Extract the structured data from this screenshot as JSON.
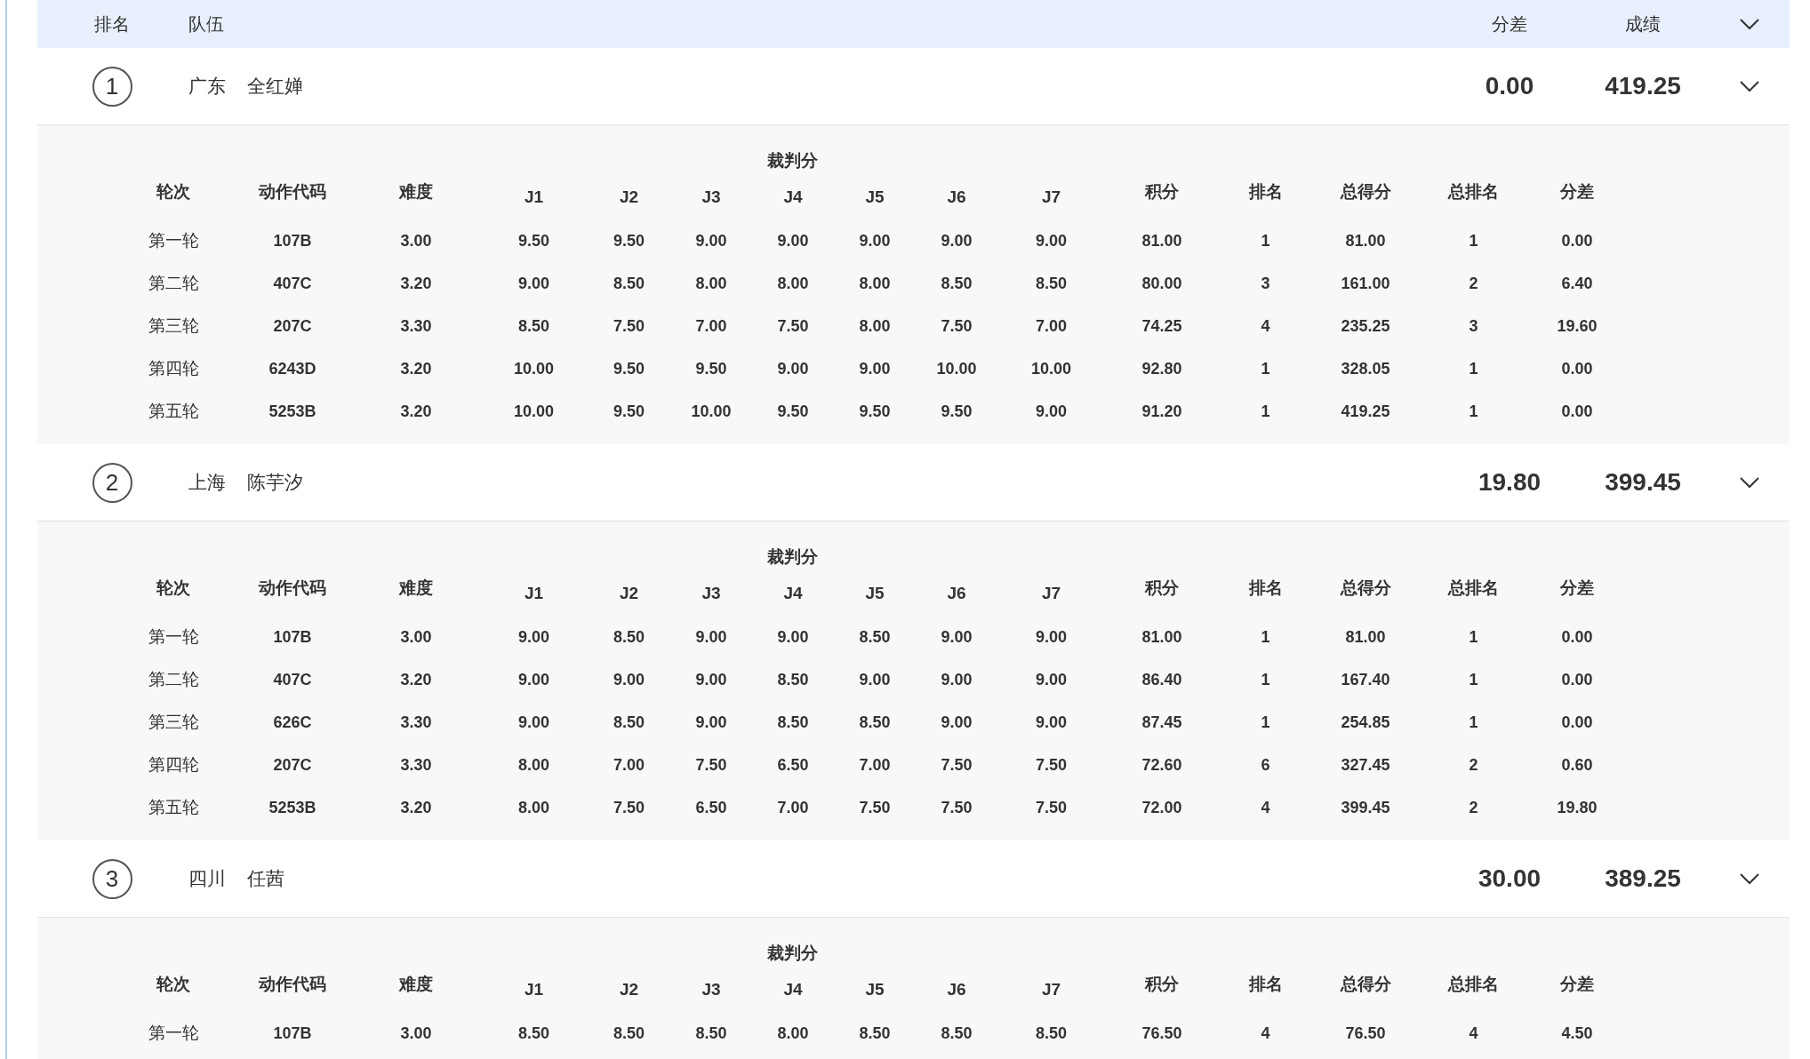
{
  "header": {
    "rank_label": "排名",
    "team_label": "队伍",
    "diff_label": "分差",
    "score_label": "成绩"
  },
  "teams": [
    {
      "rank": "1",
      "region": "广东",
      "name": "全红婵",
      "diff": "0.00",
      "score": "419.25",
      "expanded": true,
      "detail": {
        "judges_label": "裁判分",
        "columns": [
          "轮次",
          "动作代码",
          "难度",
          "J1",
          "J2",
          "J3",
          "J4",
          "J5",
          "J6",
          "J7",
          "积分",
          "排名",
          "总得分",
          "总排名",
          "分差"
        ],
        "rows": [
          [
            "第一轮",
            "107B",
            "3.00",
            "9.50",
            "9.50",
            "9.00",
            "9.00",
            "9.00",
            "9.00",
            "9.00",
            "81.00",
            "1",
            "81.00",
            "1",
            "0.00"
          ],
          [
            "第二轮",
            "407C",
            "3.20",
            "9.00",
            "8.50",
            "8.00",
            "8.00",
            "8.00",
            "8.50",
            "8.50",
            "80.00",
            "3",
            "161.00",
            "2",
            "6.40"
          ],
          [
            "第三轮",
            "207C",
            "3.30",
            "8.50",
            "7.50",
            "7.00",
            "7.50",
            "8.00",
            "7.50",
            "7.00",
            "74.25",
            "4",
            "235.25",
            "3",
            "19.60"
          ],
          [
            "第四轮",
            "6243D",
            "3.20",
            "10.00",
            "9.50",
            "9.50",
            "9.00",
            "9.00",
            "10.00",
            "10.00",
            "92.80",
            "1",
            "328.05",
            "1",
            "0.00"
          ],
          [
            "第五轮",
            "5253B",
            "3.20",
            "10.00",
            "9.50",
            "10.00",
            "9.50",
            "9.50",
            "9.50",
            "9.00",
            "91.20",
            "1",
            "419.25",
            "1",
            "0.00"
          ]
        ]
      }
    },
    {
      "rank": "2",
      "region": "上海",
      "name": "陈芋汐",
      "diff": "19.80",
      "score": "399.45",
      "expanded": true,
      "detail": {
        "judges_label": "裁判分",
        "columns": [
          "轮次",
          "动作代码",
          "难度",
          "J1",
          "J2",
          "J3",
          "J4",
          "J5",
          "J6",
          "J7",
          "积分",
          "排名",
          "总得分",
          "总排名",
          "分差"
        ],
        "rows": [
          [
            "第一轮",
            "107B",
            "3.00",
            "9.00",
            "8.50",
            "9.00",
            "9.00",
            "8.50",
            "9.00",
            "9.00",
            "81.00",
            "1",
            "81.00",
            "1",
            "0.00"
          ],
          [
            "第二轮",
            "407C",
            "3.20",
            "9.00",
            "9.00",
            "9.00",
            "8.50",
            "9.00",
            "9.00",
            "9.00",
            "86.40",
            "1",
            "167.40",
            "1",
            "0.00"
          ],
          [
            "第三轮",
            "626C",
            "3.30",
            "9.00",
            "8.50",
            "9.00",
            "8.50",
            "8.50",
            "9.00",
            "9.00",
            "87.45",
            "1",
            "254.85",
            "1",
            "0.00"
          ],
          [
            "第四轮",
            "207C",
            "3.30",
            "8.00",
            "7.00",
            "7.50",
            "6.50",
            "7.00",
            "7.50",
            "7.50",
            "72.60",
            "6",
            "327.45",
            "2",
            "0.60"
          ],
          [
            "第五轮",
            "5253B",
            "3.20",
            "8.00",
            "7.50",
            "6.50",
            "7.00",
            "7.50",
            "7.50",
            "7.50",
            "72.00",
            "4",
            "399.45",
            "2",
            "19.80"
          ]
        ]
      }
    },
    {
      "rank": "3",
      "region": "四川",
      "name": "任茜",
      "diff": "30.00",
      "score": "389.25",
      "expanded": true,
      "detail": {
        "judges_label": "裁判分",
        "columns": [
          "轮次",
          "动作代码",
          "难度",
          "J1",
          "J2",
          "J3",
          "J4",
          "J5",
          "J6",
          "J7",
          "积分",
          "排名",
          "总得分",
          "总排名",
          "分差"
        ],
        "rows": [
          [
            "第一轮",
            "107B",
            "3.00",
            "8.50",
            "8.50",
            "8.50",
            "8.00",
            "8.50",
            "8.50",
            "8.50",
            "76.50",
            "4",
            "76.50",
            "4",
            "4.50"
          ]
        ]
      }
    }
  ]
}
